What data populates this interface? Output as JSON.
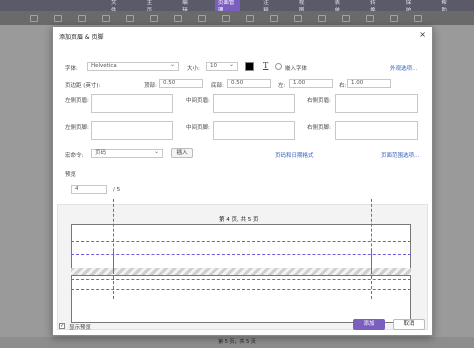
{
  "menu": [
    "文件",
    "主页",
    "编辑",
    "页面管理",
    "注释",
    "视图",
    "表单",
    "转换",
    "保护",
    "帮助"
  ],
  "status_text": "第 5 页，共 5 页",
  "dialog": {
    "title": "添加页眉 & 页脚",
    "font_label": "字体:",
    "font_value": "Helvetica",
    "size_label": "大小:",
    "size_value": "10",
    "embed_font_label": "嵌入字体",
    "appearance_link": "外观选项...",
    "margin_label": "页边距 (英寸):",
    "top_label": "顶部:",
    "top_value": "0.50",
    "bottom_label": "底部:",
    "bottom_value": "0.50",
    "left_label": "左:",
    "left_value": "1.00",
    "right_label": "右:",
    "right_value": "1.00",
    "left_header_label": "左侧页眉:",
    "center_header_label": "中间页眉:",
    "right_header_label": "右侧页眉:",
    "left_footer_label": "左侧页脚:",
    "center_footer_label": "中间页脚:",
    "right_footer_label": "右侧页脚:",
    "macro_label": "宏命令:",
    "macro_value": "页码",
    "insert_button": "插入",
    "page_date_link": "页码和日期格式",
    "page_range_link": "页面范围选项...",
    "preview_label": "预览",
    "preview_page": "4",
    "preview_total": "/ 5",
    "preview_header_text": "第 4 页, 共 5 页",
    "show_preview_label": "显示预览",
    "add_button": "添加",
    "cancel_button": "取消"
  },
  "colors": {
    "accent": "#7b5fbf",
    "guide": "#6f5fe0",
    "link": "#2f5fbf"
  }
}
